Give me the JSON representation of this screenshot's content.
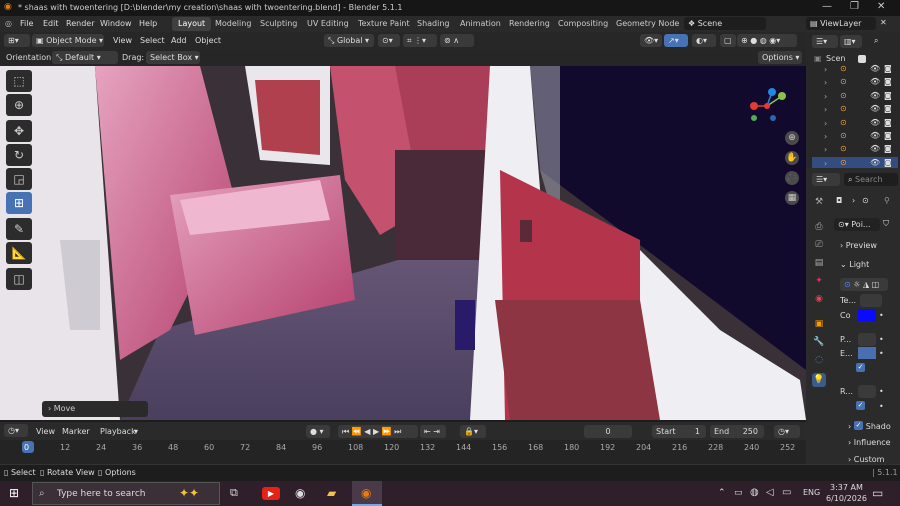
{
  "window": {
    "title": "* shaas with twoentering [D:\\blender\\my creation\\shaas with twoentering.blend] - Blender 5.1.1",
    "controls": [
      "—",
      "❐",
      "✕"
    ]
  },
  "menubar": {
    "menus": [
      "File",
      "Edit",
      "Render",
      "Window",
      "Help"
    ],
    "workspaces": [
      "Layout",
      "Modeling",
      "Sculpting",
      "UV Editing",
      "Texture Paint",
      "Shading",
      "Animation",
      "Rendering",
      "Compositing",
      "Geometry Node"
    ],
    "active_workspace": "Layout",
    "scene": "Scene",
    "view_layer": "ViewLayer"
  },
  "viewport_header": {
    "mode": "Object Mode",
    "menus": [
      "View",
      "Select",
      "Add",
      "Object"
    ],
    "transform": "Global",
    "orientation_label": "Orientation:",
    "orientation_value": "Default",
    "drag_label": "Drag:",
    "drag_value": "Select Box",
    "options": "Options"
  },
  "last_operator": "Move",
  "tools": [
    "select-box",
    "cursor",
    "move",
    "rotate",
    "scale",
    "transform",
    "annotate",
    "measure",
    "add-cube"
  ],
  "active_tool": "transform",
  "outliner": {
    "scene_label": "Scen",
    "rows": 8,
    "selected_row": 7
  },
  "properties": {
    "search_placeholder": "Search",
    "object_name": "Poi...",
    "sections": {
      "preview": "Preview",
      "light": "Light",
      "shadow": "Shado",
      "influence": "Influence",
      "custom": "Custom"
    },
    "fields": [
      "Te...",
      "Co",
      "P...",
      "E..."
    ],
    "r_field": "R...",
    "light_color": "#0a0aff",
    "e_color": "#4a6fb0"
  },
  "timeline": {
    "menus": [
      "View",
      "Marker",
      "Playback"
    ],
    "current_frame": "0",
    "start_label": "Start",
    "start": "1",
    "end_label": "End",
    "end": "250",
    "ticks": [
      "0",
      "12",
      "24",
      "36",
      "48",
      "60",
      "72",
      "84",
      "96",
      "108",
      "120",
      "132",
      "144",
      "156",
      "168",
      "180",
      "192",
      "204",
      "216",
      "228",
      "240",
      "252"
    ]
  },
  "statusbar": {
    "select": "Select",
    "rotate_view": "Rotate View",
    "options": "Options",
    "version": "5.1.1"
  },
  "taskbar": {
    "search_placeholder": "Type here to search",
    "time": "3:37 AM",
    "date": "6/10/2026",
    "lang": "ENG"
  }
}
